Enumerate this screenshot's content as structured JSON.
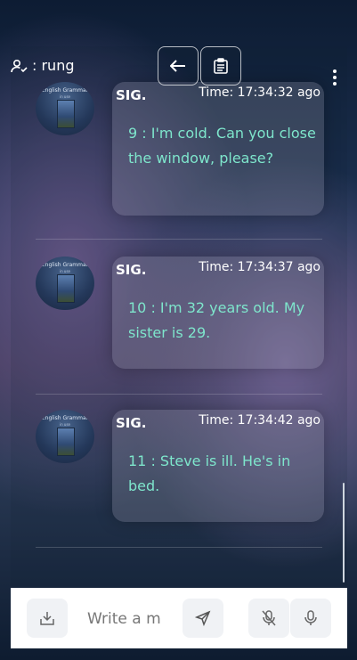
{
  "header": {
    "user_label": ": rung",
    "back_label": "back",
    "clipboard_label": "clipboard",
    "menu_label": "more"
  },
  "messages": [
    {
      "avatar_title": "English Grammar",
      "avatar_subtitle": "in use",
      "sender": "SIG.",
      "time": "Time: 17:34:32 ago",
      "text": "9 : I'm cold. Can you close the window, please?"
    },
    {
      "avatar_title": "English Grammar",
      "avatar_subtitle": "in use",
      "sender": "SIG.",
      "time": "Time: 17:34:37 ago",
      "text": "10 : I'm 32 years old. My sister is 29."
    },
    {
      "avatar_title": "English Grammar",
      "avatar_subtitle": "in use",
      "sender": "SIG.",
      "time": "Time: 17:34:42 ago",
      "text": "11 : Steve is ill. He's in bed."
    }
  ],
  "composer": {
    "placeholder": "Write a m",
    "icons": [
      "download-icon",
      "send-icon",
      "mic-off-icon",
      "mic-icon"
    ]
  },
  "colors": {
    "message_text": "#7ee6cc",
    "input_bar": "#ffffff"
  }
}
